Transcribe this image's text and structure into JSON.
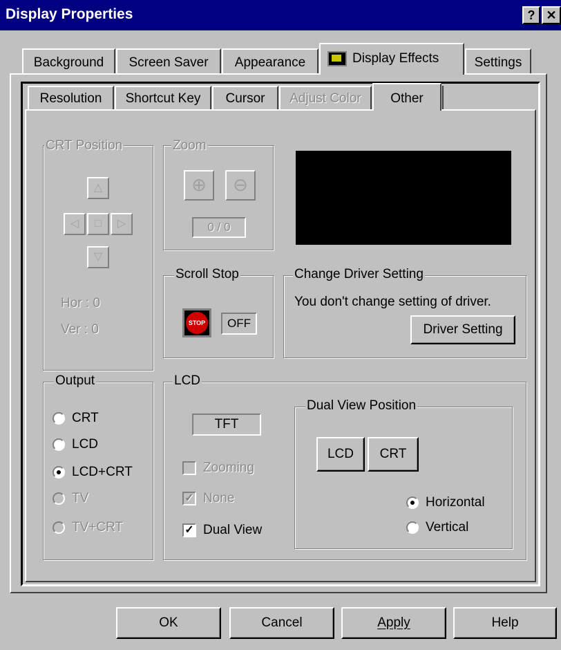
{
  "window": {
    "title": "Display Properties",
    "help_glyph": "?",
    "close_glyph": "✕"
  },
  "tabs": [
    "Background",
    "Screen Saver",
    "Appearance",
    "Display Effects",
    "Settings"
  ],
  "subtabs": [
    "Resolution",
    "Shortcut Key",
    "Cursor",
    "Adjust Color",
    "Other"
  ],
  "crt_position": {
    "label": "CRT Position",
    "hor": "Hor : 0",
    "ver": "Ver : 0",
    "up_icon": "up-arrow",
    "left_icon": "left-arrow",
    "center_icon": "center-square",
    "right_icon": "right-arrow",
    "down_icon": "down-arrow"
  },
  "zoom": {
    "label": "Zoom",
    "value": "0 / 0",
    "zoom_in_icon": "magnifier-plus",
    "zoom_out_icon": "magnifier-minus"
  },
  "scroll_stop": {
    "label": "Scroll Stop",
    "stop_icon_text": "STOP",
    "value": "OFF"
  },
  "driver": {
    "label": "Change Driver Setting",
    "message": "You don't change setting of driver.",
    "button": "Driver Setting"
  },
  "output": {
    "label": "Output",
    "options": [
      {
        "label": "CRT",
        "selected": false,
        "enabled": true
      },
      {
        "label": "LCD",
        "selected": false,
        "enabled": true
      },
      {
        "label": "LCD+CRT",
        "selected": true,
        "enabled": true
      },
      {
        "label": "TV",
        "selected": false,
        "enabled": false
      },
      {
        "label": "TV+CRT",
        "selected": false,
        "enabled": false
      }
    ]
  },
  "lcd": {
    "label": "LCD",
    "panel_type": "TFT",
    "zooming": "Zooming",
    "none": "None",
    "dual_view": "Dual View",
    "checks": {
      "zooming": false,
      "none": true,
      "dual_view": true
    },
    "dual_view_position": {
      "label": "Dual View Position",
      "lcd_button": "LCD",
      "crt_button": "CRT",
      "horizontal": "Horizontal",
      "vertical": "Vertical",
      "selected": "Horizontal"
    }
  },
  "buttons": {
    "ok": "OK",
    "cancel": "Cancel",
    "apply": "Apply",
    "help": "Help"
  },
  "colors": {
    "title_bar": "#000080",
    "face": "#c0c0c0",
    "preview": "#000000"
  }
}
